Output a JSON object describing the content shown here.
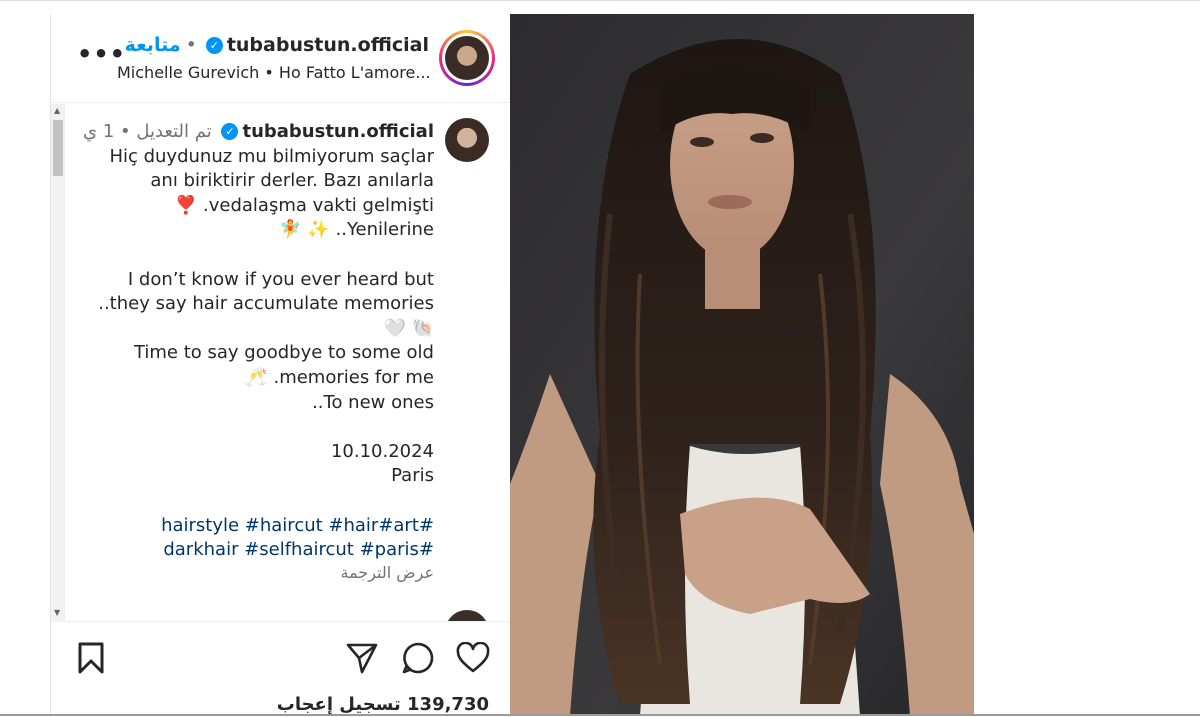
{
  "post": {
    "username": "tubabustun.official",
    "follow_label": "متابعة",
    "separator": "•",
    "audio": "Michelle Gurevich • Ho Fatto L'amore...",
    "caption_meta": "تم التعديل • 1 ي",
    "caption_lines": [
      "Hiç duydunuz mu bilmiyorum saçlar",
      "anı biriktirir derler. Bazı anılarla",
      "vedalaşma vakti gelmişti. ❣️",
      "Yenilerine.. ✨ 🧚",
      "",
      "I don’t know if you ever heard but",
      "they say hair accumulate memories..",
      "🐚 🤍",
      "Time to say goodbye to some old",
      "memories for me. 🥂",
      "To new ones..",
      "",
      "10.10.2024",
      "Paris"
    ],
    "hashtags_line1": "#hairstyle #haircut #hair#",
    "hashtags_line1_suffix": "art",
    "hashtags_line2": "#darkhair #selfhaircut #paris",
    "translate_label": "عرض الترجمة",
    "likes_label": "139,730 تسجيل إعجاب"
  },
  "icons": {
    "more": "more-options-icon",
    "verified": "verified-badge-icon",
    "save": "bookmark-icon",
    "share": "send-icon",
    "comment": "comment-icon",
    "like": "heart-icon"
  },
  "colors": {
    "follow": "#0095f6",
    "hashtag": "#00376b",
    "muted": "#737373",
    "text": "#262626"
  }
}
